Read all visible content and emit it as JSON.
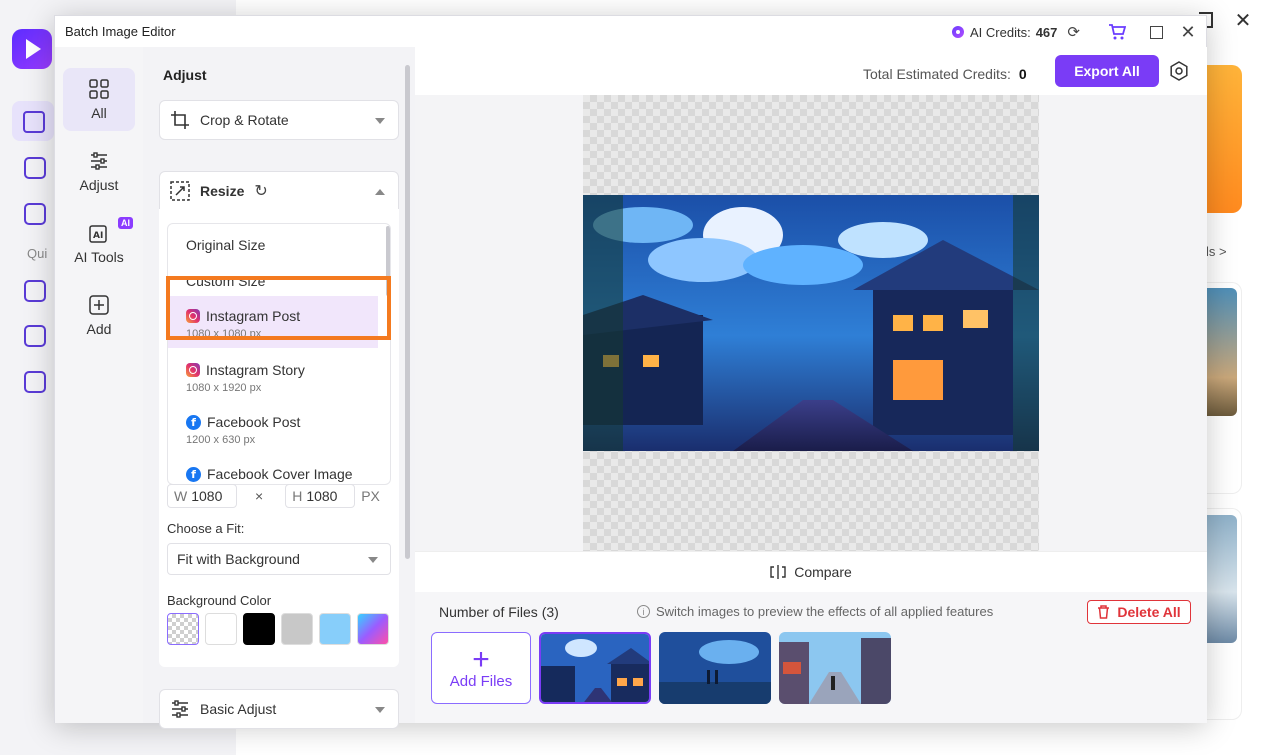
{
  "background": {
    "quick_label": "Qui",
    "link_label": "ls >"
  },
  "dialog": {
    "title": "Batch Image Editor",
    "credits_label": "AI Credits:",
    "credits_value": "467"
  },
  "rail": {
    "items": [
      {
        "label": "All",
        "icon": "grid-icon",
        "active": true
      },
      {
        "label": "Adjust",
        "icon": "sliders-icon"
      },
      {
        "label": "AI Tools",
        "icon": "ai-icon",
        "badge": "AI"
      },
      {
        "label": "Add",
        "icon": "plus-square-icon"
      }
    ]
  },
  "panel": {
    "title": "Adjust",
    "sections": {
      "crop": "Crop & Rotate",
      "resize": "Resize",
      "basic": "Basic Adjust"
    },
    "size_options": [
      {
        "label": "Original Size"
      },
      {
        "label": "Custom Size"
      },
      {
        "label": "Instagram Post",
        "sub": "1080 x 1080 px",
        "icon": "instagram-icon",
        "selected": true
      },
      {
        "label": "Instagram Story",
        "sub": "1080 x 1920 px",
        "icon": "instagram-icon"
      },
      {
        "label": "Facebook Post",
        "sub": "1200 x 630 px",
        "icon": "facebook-icon"
      },
      {
        "label": "Facebook Cover Image",
        "icon": "facebook-icon"
      }
    ],
    "width_label": "W",
    "width_value": "1080",
    "times": "×",
    "height_label": "H",
    "height_value": "1080",
    "unit": "PX",
    "fit_label": "Choose a Fit:",
    "fit_value": "Fit with Background",
    "bg_color_label": "Background Color",
    "swatches": [
      "transparent",
      "#ffffff",
      "#000000",
      "#c8c8c8",
      "#87cefa",
      "gradient"
    ]
  },
  "main": {
    "estimated_label": "Total Estimated Credits:",
    "estimated_value": "0",
    "export_label": "Export All",
    "compare_label": "Compare",
    "files_count": "Number of Files (3)",
    "files_hint": "Switch images to preview the effects of all applied features",
    "delete_label": "Delete All",
    "add_files_label": "Add Files",
    "add_files_plus": "+"
  },
  "colors": {
    "accent": "#7a3cf6",
    "highlight": "#f47a1f",
    "danger": "#e0343a"
  }
}
